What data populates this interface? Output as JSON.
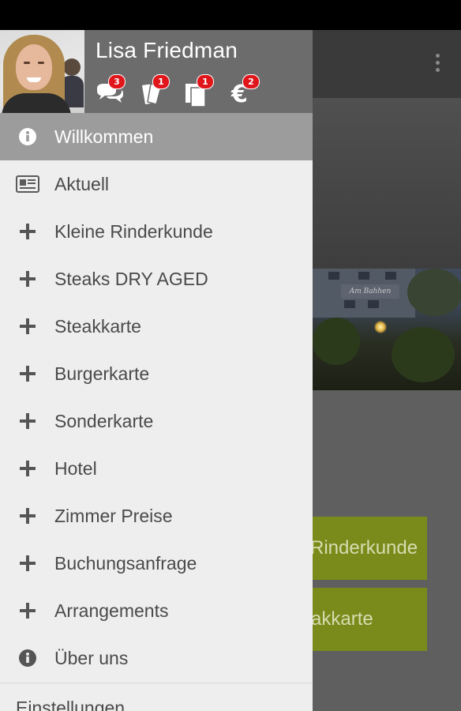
{
  "profile": {
    "name": "Lisa Friedman",
    "badges": [
      {
        "icon": "chat-icon",
        "count": "3"
      },
      {
        "icon": "tickets-icon",
        "count": "1"
      },
      {
        "icon": "documents-icon",
        "count": "1"
      },
      {
        "icon": "euro-icon",
        "count": "2"
      }
    ]
  },
  "menu": [
    {
      "icon": "info-icon",
      "label": "Willkommen",
      "active": true
    },
    {
      "icon": "newspaper-icon",
      "label": "Aktuell"
    },
    {
      "icon": "plus-icon",
      "label": "Kleine Rinderkunde"
    },
    {
      "icon": "plus-icon",
      "label": "Steaks DRY AGED"
    },
    {
      "icon": "plus-icon",
      "label": "Steakkarte"
    },
    {
      "icon": "plus-icon",
      "label": "Burgerkarte"
    },
    {
      "icon": "plus-icon",
      "label": "Sonderkarte"
    },
    {
      "icon": "plus-icon",
      "label": "Hotel"
    },
    {
      "icon": "plus-icon",
      "label": "Zimmer Preise"
    },
    {
      "icon": "plus-icon",
      "label": "Buchungsanfrage"
    },
    {
      "icon": "plus-icon",
      "label": "Arrangements"
    },
    {
      "icon": "info-icon",
      "label": "Über uns"
    }
  ],
  "settings_label": "Einstellungen",
  "background": {
    "button1": "Rinderkunde",
    "button2": "akkarte",
    "hotel_sign": "Am Bahhen"
  },
  "colors": {
    "drawer_bg": "#eeeeee",
    "header_bg": "#6c6c6c",
    "active_item": "#9c9c9c",
    "badge": "#e0161b",
    "accent_olive": "#7a8b1b"
  }
}
